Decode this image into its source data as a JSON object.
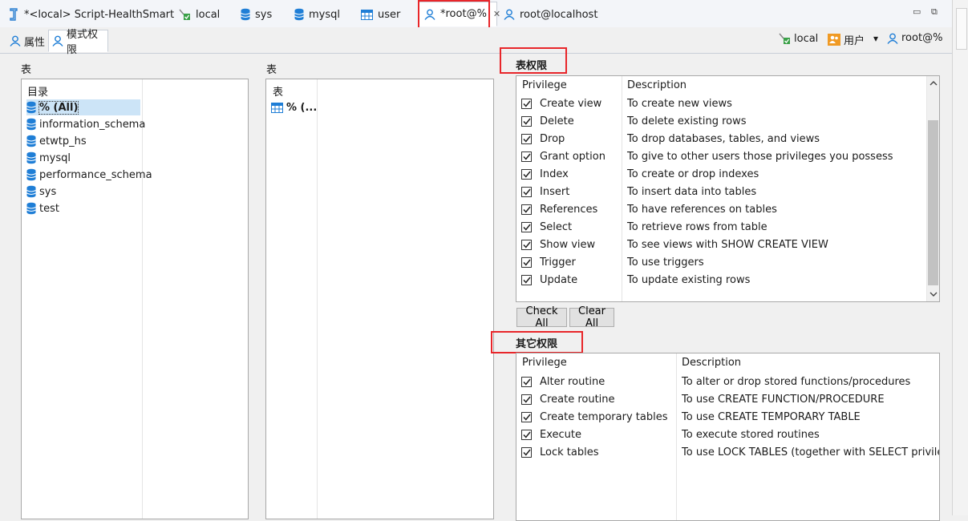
{
  "editor_tabs": [
    {
      "label": "*<local> Script-HealthSmart",
      "icon": "script-icon"
    },
    {
      "label": "local",
      "icon": "connection-icon"
    },
    {
      "label": "sys",
      "icon": "database-icon"
    },
    {
      "label": "mysql",
      "icon": "database-icon"
    },
    {
      "label": "user",
      "icon": "table-icon"
    },
    {
      "label": "*root@%",
      "icon": "user-icon",
      "close": "✕"
    },
    {
      "label": "root@localhost",
      "icon": "user-icon"
    }
  ],
  "window_controls": {
    "minimize": "▭",
    "restore": "⧉"
  },
  "inner_tabs": [
    {
      "label": "属性",
      "icon": "user-icon"
    },
    {
      "label": "模式权限",
      "icon": "user-icon"
    }
  ],
  "toolbar": {
    "connection": "local",
    "users": "用户",
    "dropdown": "▾",
    "user": "root@%"
  },
  "catalog_panel": {
    "label": "表",
    "header": "目录",
    "items": [
      "% (All)",
      "information_schema",
      "etwtp_hs",
      "mysql",
      "performance_schema",
      "sys",
      "test"
    ]
  },
  "table_panel": {
    "label": "表",
    "header": "表",
    "items": [
      "% (..."
    ]
  },
  "table_privileges": {
    "title": "表权限",
    "headers": {
      "privilege": "Privilege",
      "description": "Description"
    },
    "rows": [
      {
        "name": "Create view",
        "desc": "To create new views",
        "checked": true
      },
      {
        "name": "Delete",
        "desc": "To delete existing rows",
        "checked": true
      },
      {
        "name": "Drop",
        "desc": "To drop databases, tables, and views",
        "checked": true
      },
      {
        "name": "Grant option",
        "desc": "To give to other users those privileges you possess",
        "checked": true
      },
      {
        "name": "Index",
        "desc": "To create or drop indexes",
        "checked": true
      },
      {
        "name": "Insert",
        "desc": "To insert data into tables",
        "checked": true
      },
      {
        "name": "References",
        "desc": "To have references on tables",
        "checked": true
      },
      {
        "name": "Select",
        "desc": "To retrieve rows from table",
        "checked": true
      },
      {
        "name": "Show view",
        "desc": "To see views with SHOW CREATE VIEW",
        "checked": true
      },
      {
        "name": "Trigger",
        "desc": "To use triggers",
        "checked": true
      },
      {
        "name": "Update",
        "desc": "To update existing rows",
        "checked": true
      }
    ]
  },
  "buttons": {
    "check_all": "Check All",
    "clear_all": "Clear All"
  },
  "other_privileges": {
    "title": "其它权限",
    "headers": {
      "privilege": "Privilege",
      "description": "Description"
    },
    "rows": [
      {
        "name": "Alter routine",
        "desc": "To alter or drop stored functions/procedures",
        "checked": true
      },
      {
        "name": "Create routine",
        "desc": "To use CREATE FUNCTION/PROCEDURE",
        "checked": true
      },
      {
        "name": "Create temporary tables",
        "desc": "To use CREATE TEMPORARY TABLE",
        "checked": true
      },
      {
        "name": "Execute",
        "desc": "To execute stored routines",
        "checked": true
      },
      {
        "name": "Lock tables",
        "desc": "To use LOCK TABLES (together with SELECT privilege)",
        "checked": true
      }
    ]
  },
  "colors": {
    "accent": "#1a73c7",
    "highlight": "#e8262a",
    "selection": "#cce4f7"
  }
}
